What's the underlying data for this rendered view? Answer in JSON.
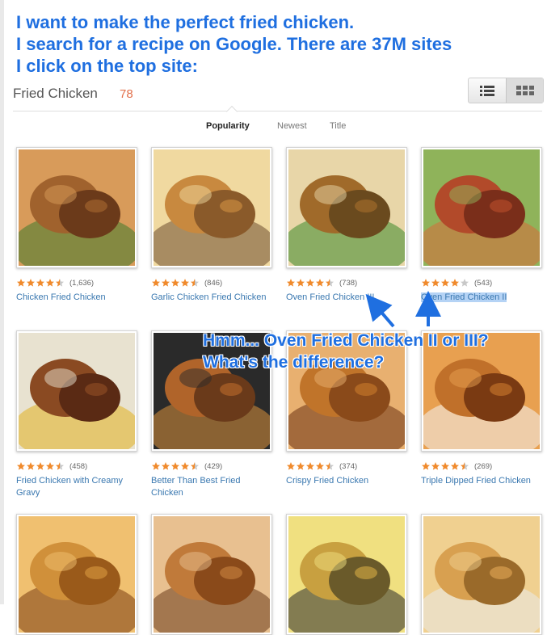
{
  "annotations": {
    "top": [
      "I want to make the perfect fried chicken.",
      "I search for a recipe on Google. There are 37M sites",
      "I click on the top site:"
    ],
    "middle": [
      "Hmm... Oven Fried Chicken II or III?",
      "What's the difference?"
    ]
  },
  "header": {
    "title": "Fried Chicken",
    "count": "78"
  },
  "view_toggle": {
    "options": [
      "list-view-icon",
      "grid-view-icon"
    ],
    "active": "grid"
  },
  "sort_tabs": [
    {
      "label": "Popularity",
      "active": true
    },
    {
      "label": "Newest",
      "active": false
    },
    {
      "label": "Title",
      "active": false
    }
  ],
  "colors": {
    "accent_link": "#3a78b0",
    "star": "#f08a2c",
    "count": "#e2704b",
    "annotation": "#1f6fe0"
  },
  "recipes": [
    {
      "title": "Chicken Fried Chicken",
      "reviews": "(1,636)",
      "stars": 4.5
    },
    {
      "title": "Garlic Chicken Fried Chicken",
      "reviews": "(846)",
      "stars": 4.5
    },
    {
      "title": "Oven Fried Chicken III",
      "reviews": "(738)",
      "stars": 4.5
    },
    {
      "title": "Oven Fried Chicken II",
      "reviews": "(543)",
      "stars": 4,
      "highlighted": true
    },
    {
      "title": "Fried Chicken with Creamy Gravy",
      "reviews": "(458)",
      "stars": 4.5
    },
    {
      "title": "Better Than Best Fried Chicken",
      "reviews": "(429)",
      "stars": 4.5
    },
    {
      "title": "Crispy Fried Chicken",
      "reviews": "(374)",
      "stars": 4.5
    },
    {
      "title": "Triple Dipped Fried Chicken",
      "reviews": "(269)",
      "stars": 4.5
    },
    {
      "title": "",
      "reviews": "",
      "stars": 0
    },
    {
      "title": "",
      "reviews": "",
      "stars": 0
    },
    {
      "title": "",
      "reviews": "",
      "stars": 0
    },
    {
      "title": "",
      "reviews": "",
      "stars": 0
    }
  ]
}
